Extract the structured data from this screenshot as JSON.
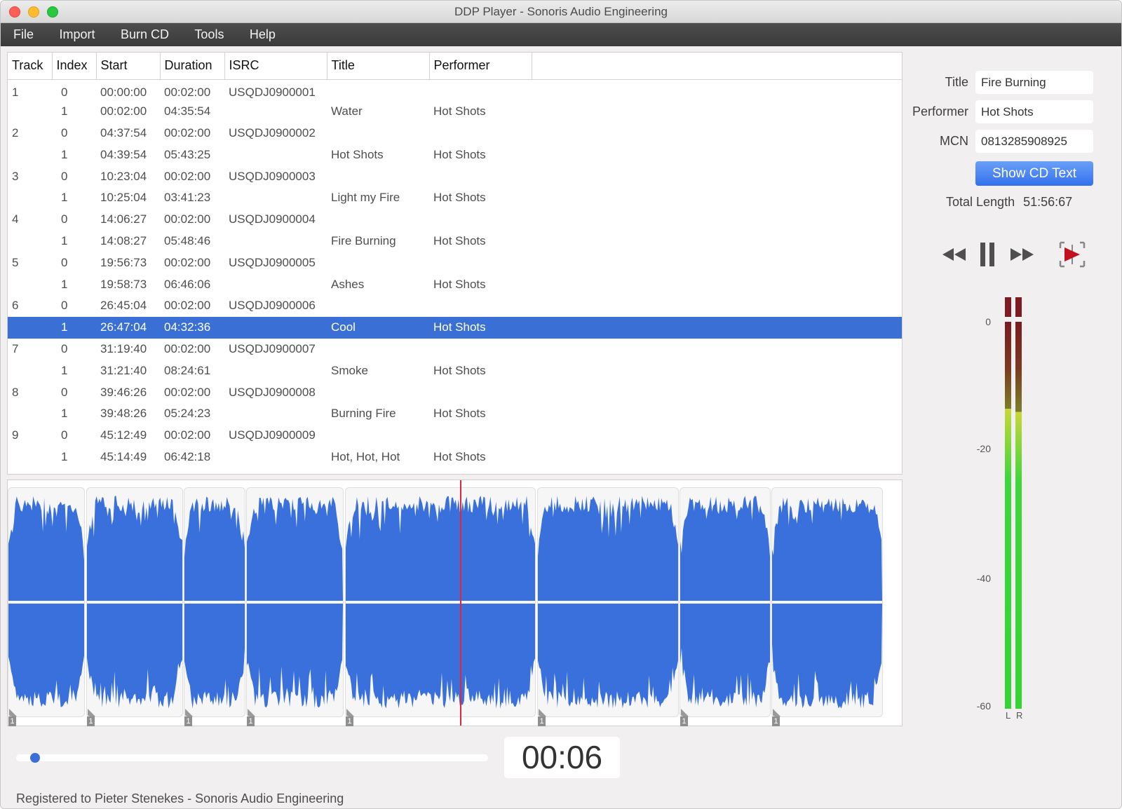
{
  "window": {
    "title": "DDP Player - Sonoris Audio Engineering",
    "traffic_lights": [
      "close",
      "minimize",
      "maximize"
    ]
  },
  "menu": [
    "File",
    "Import",
    "Burn CD",
    "Tools",
    "Help"
  ],
  "tracklist": {
    "columns": [
      "Track",
      "Index",
      "Start",
      "Duration",
      "ISRC",
      "Title",
      "Performer"
    ],
    "selected_row": 11,
    "rows": [
      {
        "track": "1",
        "index": "0",
        "start": "00:00:00",
        "duration": "00:02:00",
        "isrc": "USQDJ0900001",
        "title": "",
        "performer": ""
      },
      {
        "track": "",
        "index": "1",
        "start": "00:02:00",
        "duration": "04:35:54",
        "isrc": "",
        "title": "Water",
        "performer": "Hot Shots"
      },
      {
        "track": "2",
        "index": "0",
        "start": "04:37:54",
        "duration": "00:02:00",
        "isrc": "USQDJ0900002",
        "title": "",
        "performer": ""
      },
      {
        "track": "",
        "index": "1",
        "start": "04:39:54",
        "duration": "05:43:25",
        "isrc": "",
        "title": "Hot Shots",
        "performer": "Hot Shots"
      },
      {
        "track": "3",
        "index": "0",
        "start": "10:23:04",
        "duration": "00:02:00",
        "isrc": "USQDJ0900003",
        "title": "",
        "performer": ""
      },
      {
        "track": "",
        "index": "1",
        "start": "10:25:04",
        "duration": "03:41:23",
        "isrc": "",
        "title": "Light my Fire",
        "performer": "Hot Shots"
      },
      {
        "track": "4",
        "index": "0",
        "start": "14:06:27",
        "duration": "00:02:00",
        "isrc": "USQDJ0900004",
        "title": "",
        "performer": ""
      },
      {
        "track": "",
        "index": "1",
        "start": "14:08:27",
        "duration": "05:48:46",
        "isrc": "",
        "title": "Fire Burning",
        "performer": "Hot Shots"
      },
      {
        "track": "5",
        "index": "0",
        "start": "19:56:73",
        "duration": "00:02:00",
        "isrc": "USQDJ0900005",
        "title": "",
        "performer": ""
      },
      {
        "track": "",
        "index": "1",
        "start": "19:58:73",
        "duration": "06:46:06",
        "isrc": "",
        "title": "Ashes",
        "performer": "Hot Shots"
      },
      {
        "track": "6",
        "index": "0",
        "start": "26:45:04",
        "duration": "00:02:00",
        "isrc": "USQDJ0900006",
        "title": "",
        "performer": ""
      },
      {
        "track": "",
        "index": "1",
        "start": "26:47:04",
        "duration": "04:32:36",
        "isrc": "",
        "title": "Cool",
        "performer": "Hot Shots"
      },
      {
        "track": "7",
        "index": "0",
        "start": "31:19:40",
        "duration": "00:02:00",
        "isrc": "USQDJ0900007",
        "title": "",
        "performer": ""
      },
      {
        "track": "",
        "index": "1",
        "start": "31:21:40",
        "duration": "08:24:61",
        "isrc": "",
        "title": "Smoke",
        "performer": "Hot Shots"
      },
      {
        "track": "8",
        "index": "0",
        "start": "39:46:26",
        "duration": "00:02:00",
        "isrc": "USQDJ0900008",
        "title": "",
        "performer": ""
      },
      {
        "track": "",
        "index": "1",
        "start": "39:48:26",
        "duration": "05:24:23",
        "isrc": "",
        "title": "Burning Fire",
        "performer": "Hot Shots"
      },
      {
        "track": "9",
        "index": "0",
        "start": "45:12:49",
        "duration": "00:02:00",
        "isrc": "USQDJ0900009",
        "title": "",
        "performer": ""
      },
      {
        "track": "",
        "index": "1",
        "start": "45:14:49",
        "duration": "06:42:18",
        "isrc": "",
        "title": "Hot, Hot, Hot",
        "performer": "Hot Shots"
      }
    ]
  },
  "waveform": {
    "color": "#3a70dc",
    "playhead_color": "#e0263e",
    "index_badge": "1",
    "segments_count": 9,
    "playhead_track": 6,
    "playhead_fraction_in_track": 0.0
  },
  "cd_info": {
    "title_label": "Title",
    "title_value": "Fire Burning",
    "performer_label": "Performer",
    "performer_value": "Hot Shots",
    "mcn_label": "MCN",
    "mcn_value": "0813285908925",
    "show_cd_text_label": "Show CD Text",
    "total_length_label": "Total Length",
    "total_length_value": "51:56:67"
  },
  "transport": {
    "rewind_icon": "rewind-icon",
    "pause_icon": "pause-icon",
    "fast_forward_icon": "fast-forward-icon",
    "play_selection_icon": "play-range-icon",
    "accent_color": "#c4101c"
  },
  "meter": {
    "scale_labels": [
      "0",
      "-20",
      "-40",
      "-60"
    ],
    "channels": [
      "L",
      "R"
    ],
    "levels_db": {
      "L": -13.5,
      "R": -14
    },
    "clip_indicator_color": "#7e1a22"
  },
  "playback": {
    "position_fraction": 0.03,
    "time_display": "00:06"
  },
  "footer": {
    "registration": "Registered to Pieter Stenekes - Sonoris Audio Engineering"
  }
}
